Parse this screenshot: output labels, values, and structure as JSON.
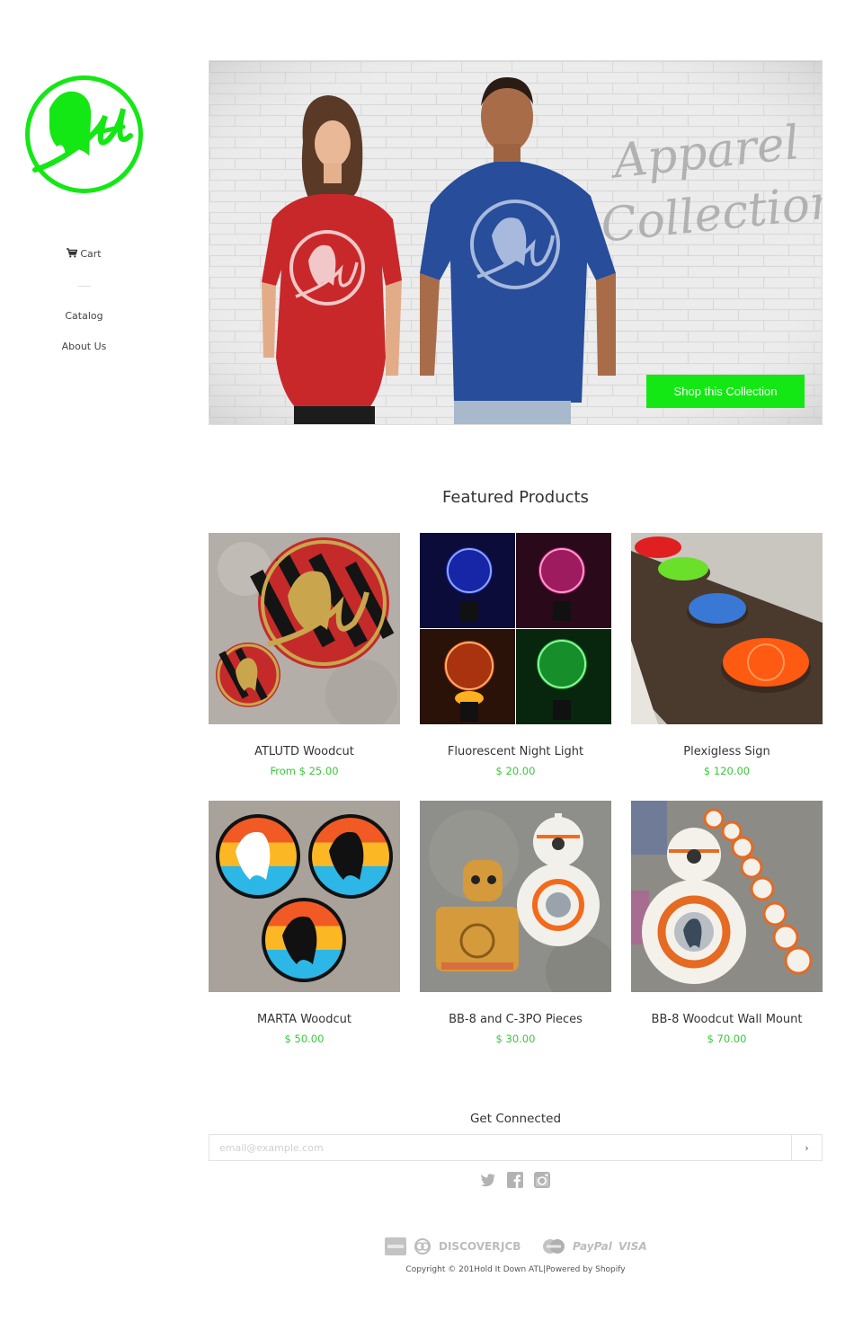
{
  "colors": {
    "accent": "#14e814",
    "price": "#3cc63c",
    "text": "#333333"
  },
  "brand": {
    "logo_text": "Atl"
  },
  "nav": {
    "cart_label": "Cart",
    "cart_icon": "shopping-cart-icon",
    "links": [
      {
        "label": "Catalog"
      },
      {
        "label": "About Us"
      }
    ]
  },
  "hero": {
    "headline_line1": "Apparel",
    "headline_line2": "Collection",
    "cta_label": "Shop this Collection"
  },
  "featured": {
    "title": "Featured Products",
    "products": [
      {
        "name": "ATLUTD Woodcut",
        "price": "From $ 25.00"
      },
      {
        "name": "Fluorescent Night Light",
        "price": "$ 20.00"
      },
      {
        "name": "Plexigless Sign",
        "price": "$ 120.00"
      },
      {
        "name": "MARTA Woodcut",
        "price": "$ 50.00"
      },
      {
        "name": "BB-8 and C-3PO Pieces",
        "price": "$ 30.00"
      },
      {
        "name": "BB-8 Woodcut Wall Mount",
        "price": "$ 70.00"
      }
    ]
  },
  "footer": {
    "newsletter_title": "Get Connected",
    "email_placeholder": "email@example.com",
    "submit_label": "›",
    "social": [
      "twitter-icon",
      "facebook-icon",
      "instagram-icon"
    ],
    "payments": {
      "diners": "",
      "discover": "DISCOVER",
      "jcb": "JCB",
      "paypal": "PayPal",
      "visa": "VISA"
    },
    "copyright_prefix": "Copyright © 201",
    "shop_name": "Hold It Down ATL",
    "separator": "|",
    "powered_by": "Powered by Shopify"
  }
}
